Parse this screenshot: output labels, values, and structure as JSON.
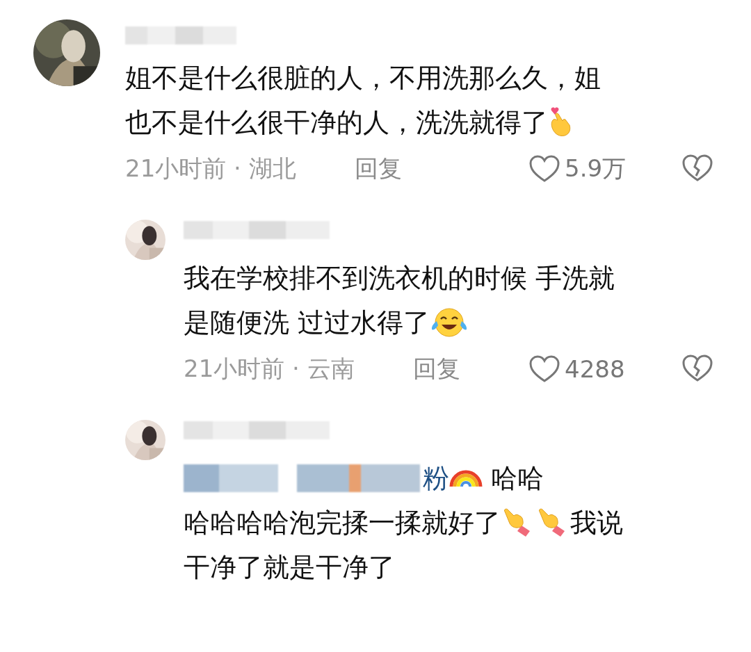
{
  "comments": [
    {
      "avatar": {
        "kind": "picture"
      },
      "lines": [
        [
          {
            "kind": "text",
            "text": "姐不是什么很脏的人，不用洗那么久，姐"
          }
        ],
        [
          {
            "kind": "text",
            "text": "也不是什么很干净的人，洗洗就得了"
          },
          {
            "kind": "finger-heart"
          }
        ]
      ],
      "meta": "21小时前 · 湖北",
      "reply": "回复",
      "likes": "5.9万",
      "replies": [
        {
          "avatar": {
            "kind": "picture"
          },
          "lines": [
            [
              {
                "kind": "text",
                "text": "我在学校排不到洗衣机的时候 手洗就"
              }
            ],
            [
              {
                "kind": "text",
                "text": "是随便洗 过过水得了"
              },
              {
                "kind": "tears-of-joy"
              }
            ]
          ],
          "meta": "21小时前 · 云南",
          "reply": "回复",
          "likes": "4288"
        },
        {
          "avatar": {
            "kind": "picture"
          },
          "lines": [
            [
              {
                "kind": "redacted"
              },
              {
                "kind": "mention",
                "text": "粉"
              },
              {
                "kind": "rainbow"
              },
              {
                "kind": "text",
                "text": " 哈哈"
              }
            ],
            [
              {
                "kind": "text",
                "text": "哈哈哈哈泡完揉一揉就好了"
              },
              {
                "kind": "pointing-hand"
              },
              {
                "kind": "pointing-hand"
              },
              {
                "kind": "text",
                "text": "我说"
              }
            ],
            [
              {
                "kind": "text",
                "text": "干净了就是干净了"
              }
            ]
          ]
        }
      ]
    }
  ]
}
